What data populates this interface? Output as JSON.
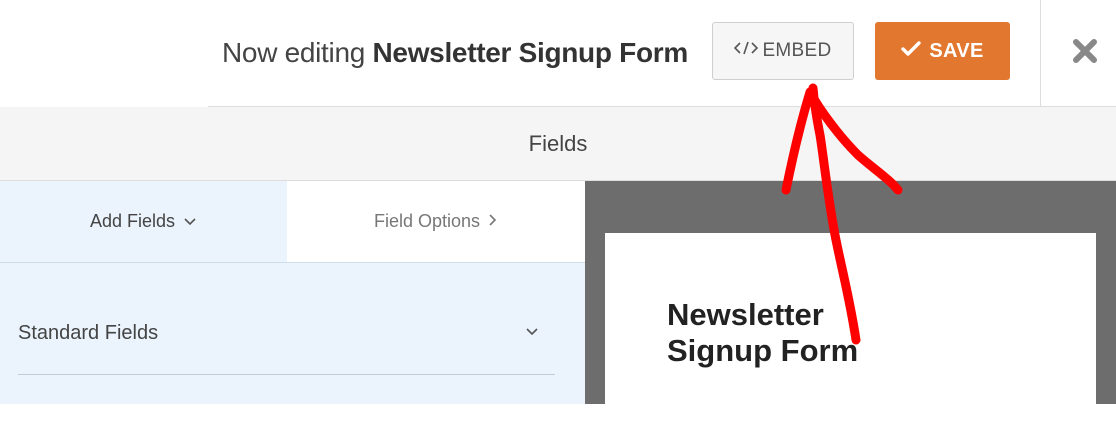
{
  "header": {
    "title_prefix": "Now editing",
    "form_name": "Newsletter Signup Form",
    "embed_label": "EMBED",
    "embed_icon": "code-icon",
    "save_label": "SAVE",
    "save_icon": "check-icon",
    "close_icon": "close-icon"
  },
  "fields_panel": {
    "title": "Fields"
  },
  "tabs": [
    {
      "label": "Add Fields",
      "icon": "chevron-down-icon",
      "active": true
    },
    {
      "label": "Field Options",
      "icon": "chevron-right-icon",
      "active": false
    }
  ],
  "sections": [
    {
      "label": "Standard Fields",
      "icon": "chevron-down-icon"
    }
  ],
  "preview": {
    "form_title": "Newsletter Signup Form"
  },
  "colors": {
    "save_bg": "#e27730",
    "panel_bg": "#ebf3fc",
    "preview_bg": "#6d6d6d",
    "annotation_arrow": "#ff0000"
  }
}
